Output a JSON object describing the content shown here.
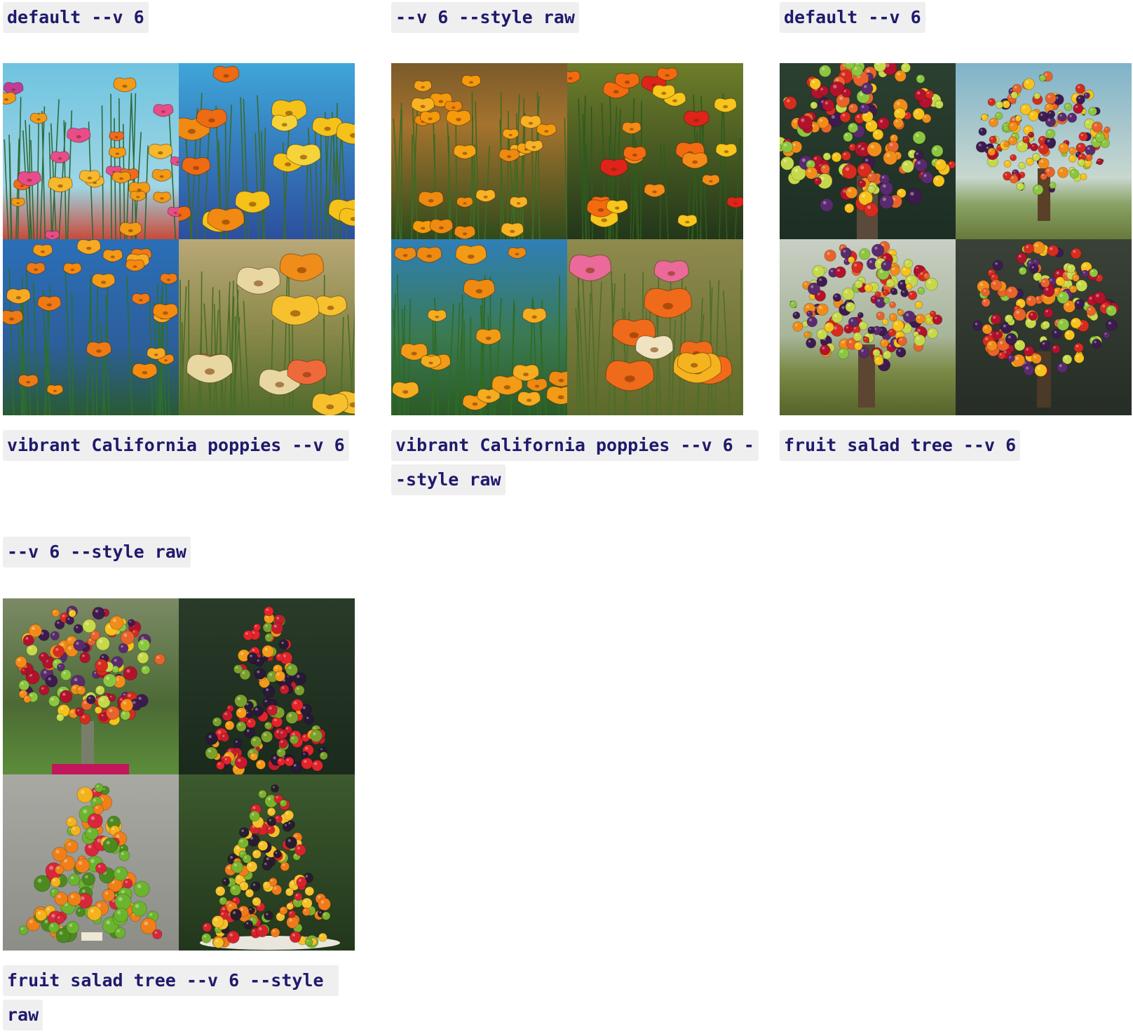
{
  "page": {
    "background": "#ffffff",
    "label_text_color": "#1f1a6b",
    "label_background": "#efeff0"
  },
  "groups": [
    {
      "header": "default --v 6",
      "caption": "vibrant California poppies --v 6",
      "tiles": [
        "poppy-painting-sky",
        "poppy-painting-stained-glass",
        "poppy-painting-blue",
        "poppy-painting-impasto"
      ]
    },
    {
      "header": "--v 6 --style raw",
      "caption": "vibrant California poppies --v 6 --style raw",
      "tiles": [
        "poppy-photo-field",
        "poppy-photo-red-orange",
        "poppy-painting-blue-green",
        "poppy-painting-impasto-pink"
      ]
    },
    {
      "header": "default --v 6",
      "caption": "fruit salad tree --v 6",
      "tiles": [
        "fruit-tree-painting-dense",
        "fruit-tree-painting-landscape",
        "fruit-tree-painting-meadow",
        "fruit-tree-painting-dark"
      ]
    },
    {
      "header": "--v 6 --style raw",
      "caption": "fruit salad tree --v 6 --style raw",
      "tiles": [
        "fruit-topiary-garden",
        "fruit-cone-berries",
        "fruit-tower-grey",
        "fruit-cone-garden"
      ]
    }
  ]
}
